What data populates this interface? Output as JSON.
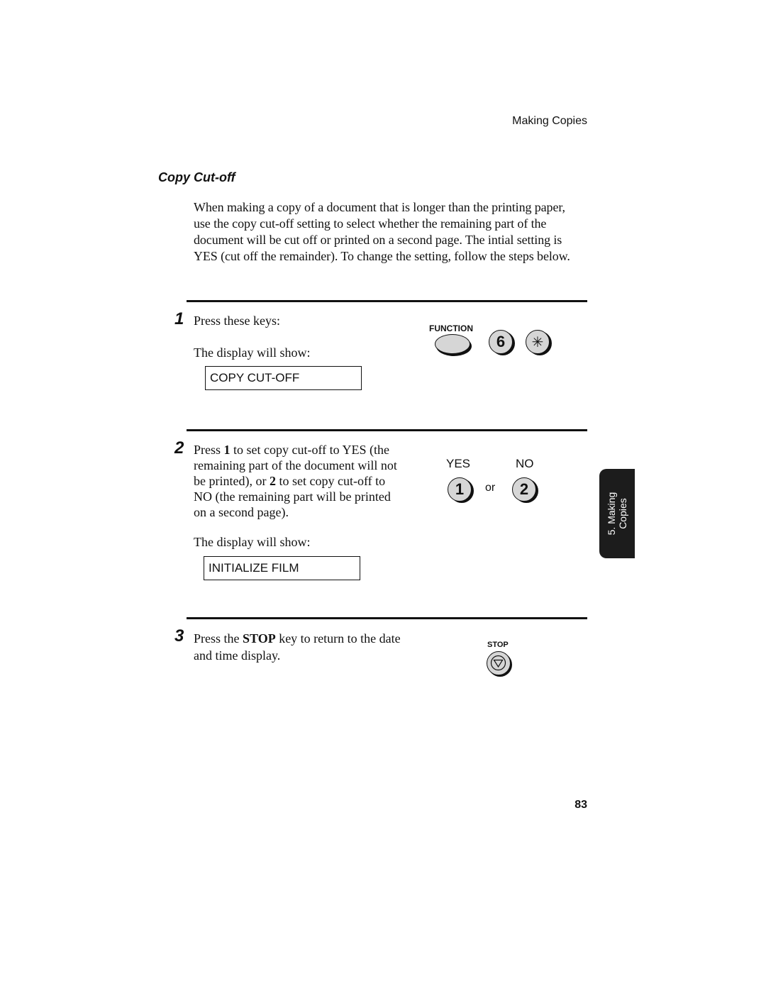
{
  "header": {
    "running_title": "Making Copies"
  },
  "section": {
    "title": "Copy Cut-off",
    "intro": "When making a copy of a document that is longer than the printing paper, use the copy cut-off setting to select whether the remaining part of the document will be cut off or printed on a second page. The intial setting is YES (cut off the remainder). To change the setting, follow the steps below."
  },
  "steps": [
    {
      "number": "1",
      "text": "Press these keys:",
      "display_label": "The display will show:",
      "display_value": "COPY CUT-OFF",
      "keys": {
        "function_label": "FUNCTION",
        "key_6": "6",
        "key_star": "✳"
      }
    },
    {
      "number": "2",
      "text_parts": {
        "a": "Press ",
        "b": "1",
        "c": " to set copy cut-off to YES (the remaining part of the document will not be printed), or ",
        "d": "2",
        "e": " to set copy cut-off to NO (the remaining part will be printed on a second page)."
      },
      "display_label": "The display will show:",
      "display_value": "INITIALIZE FILM",
      "options": {
        "yes_label": "YES",
        "no_label": "NO",
        "key_1": "1",
        "key_2": "2",
        "or": "or"
      }
    },
    {
      "number": "3",
      "text_parts": {
        "a": "Press the ",
        "b": "STOP",
        "c": " key to return to the date and time display."
      },
      "keys": {
        "stop_label": "STOP"
      }
    }
  ],
  "side_tab": {
    "line1": "5. Making",
    "line2": "Copies"
  },
  "footer": {
    "page_number": "83"
  }
}
